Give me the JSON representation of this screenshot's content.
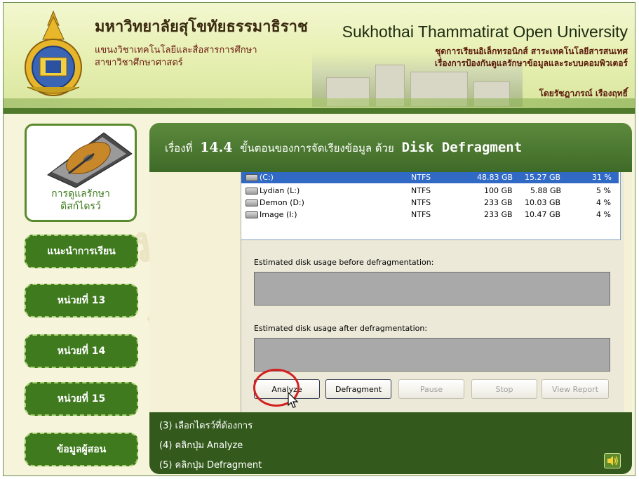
{
  "header": {
    "university_th": "มหาวิทยาลัยสุโขทัยธรรมาธิราช",
    "department_line1": "แขนงวิชาเทคโนโลยีและสื่อสารการศึกษา",
    "department_line2": "สาขาวิชาศึกษาศาสตร์",
    "university_en": "Sukhothai Thammatirat Open University",
    "series_line1": "ชุดการเรียนอิเล็กทรอนิกส์ สาระเทคโนโลยีสารสนเทศ",
    "series_line2": "เรื่องการป้องกันดูแลรักษาข้อมูลและระบบคอมพิวเตอร์",
    "author": "โดยรัชฎาภรณ์ เรืองฤทธิ์",
    "watermark": "มหาวิทยาลัยสุโขทัยธรรมาธิราช"
  },
  "sidebar": {
    "image_label_line1": "การดูแลรักษา",
    "image_label_line2": "ดิสก์ไดรว์",
    "buttons": [
      {
        "label": "แนะนำการเรียน"
      },
      {
        "label": "หน่วยที่ 13"
      },
      {
        "label": "หน่วยที่ 14"
      },
      {
        "label": "หน่วยที่ 15"
      },
      {
        "label": "ข้อมูลผู้สอน"
      }
    ]
  },
  "main": {
    "title_prefix": "เรื่องที่",
    "title_number": "14.4",
    "title_text": "ขั้นตอนของการจัดเรียงข้อมูล ด้วย",
    "title_app": "Disk Defragment",
    "volumes": [
      {
        "name": "(C:)",
        "fs": "NTFS",
        "capacity": "48.83 GB",
        "free": "15.27 GB",
        "pct": "31 %"
      },
      {
        "name": "Lydian (L:)",
        "fs": "NTFS",
        "capacity": "100 GB",
        "free": "5.88 GB",
        "pct": "5 %"
      },
      {
        "name": "Demon (D:)",
        "fs": "NTFS",
        "capacity": "233 GB",
        "free": "10.03 GB",
        "pct": "4 %"
      },
      {
        "name": "Image (I:)",
        "fs": "NTFS",
        "capacity": "233 GB",
        "free": "10.47 GB",
        "pct": "4 %"
      }
    ],
    "est_before_label": "Estimated disk usage before defragmentation:",
    "est_after_label": "Estimated disk usage after defragmentation:",
    "buttons": {
      "analyze": "Analyze",
      "defragment": "Defragment",
      "pause": "Pause",
      "stop": "Stop",
      "view_report": "View Report"
    },
    "instructions": [
      "(3) เลือกไดรว์ที่ต้องการ",
      "(4) คลิกปุ่ม Analyze",
      "(5) คลิกปุ่ม Defragment"
    ]
  },
  "colors": {
    "accent_green": "#3f7a1e",
    "selection_blue": "#316ac5",
    "highlight_red": "#d42020"
  }
}
